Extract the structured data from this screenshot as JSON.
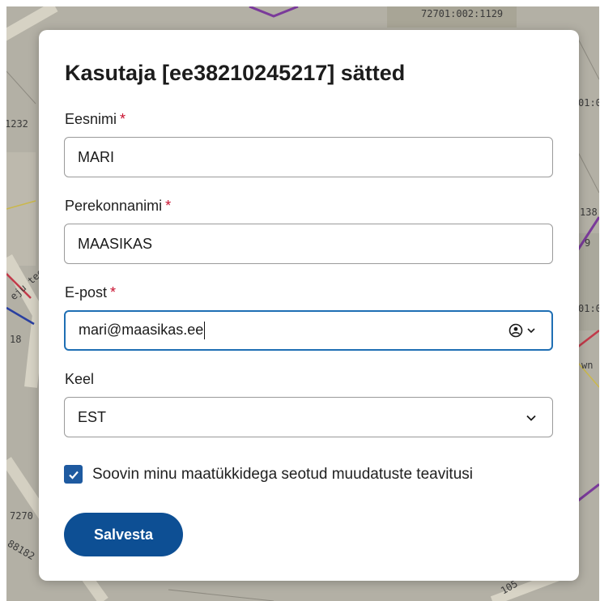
{
  "map": {
    "labels": [
      "72701:002:1129",
      "1232",
      "01:0",
      "138",
      "9",
      "eju tee",
      "18",
      "01:0",
      "wn",
      "7270",
      "88182",
      "105"
    ]
  },
  "dialog": {
    "title": "Kasutaja [ee38210245217] sätted",
    "required_marker": "*",
    "fields": {
      "first_name": {
        "label": "Eesnimi",
        "value": "MARI"
      },
      "last_name": {
        "label": "Perekonnanimi",
        "value": "MAASIKAS"
      },
      "email": {
        "label": "E-post",
        "value": "mari@maasikas.ee"
      },
      "language": {
        "label": "Keel",
        "value": "EST"
      }
    },
    "notifications": {
      "checked": true,
      "label": "Soovin minu maatükkidega seotud muudatuste teavitusi"
    },
    "save_label": "Salvesta"
  },
  "colors": {
    "primary": "#0d4f94",
    "checkbox": "#1e5aa0",
    "focus_border": "#1f6fb4",
    "required": "#c8102e"
  },
  "icons": {
    "autofill": "contact-autofill-icon",
    "dropdown": "chevron-down-icon",
    "check": "checkmark-icon"
  }
}
